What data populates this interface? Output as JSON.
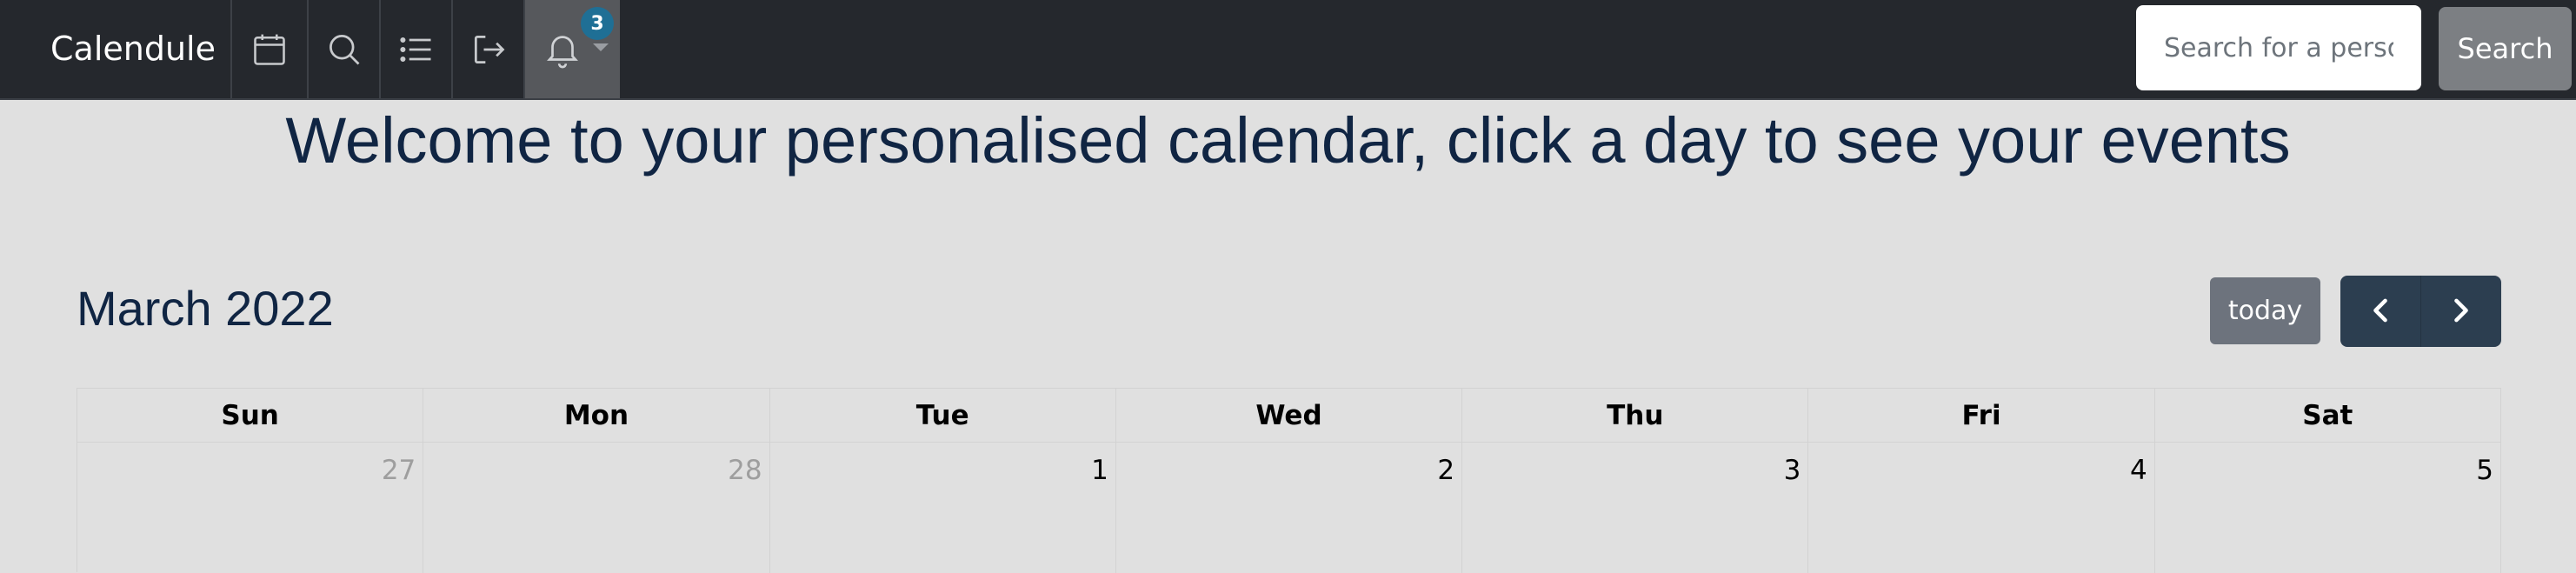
{
  "navbar": {
    "brand": "Calendule",
    "icons": [
      {
        "name": "calendar-icon"
      },
      {
        "name": "search-icon"
      },
      {
        "name": "list-icon"
      },
      {
        "name": "logout-icon"
      },
      {
        "name": "bell-icon",
        "badge": "3"
      }
    ],
    "search": {
      "placeholder": "Search for a person",
      "value": "",
      "button_label": "Search"
    }
  },
  "main": {
    "welcome": "Welcome to your personalised calendar, click a day to see your events"
  },
  "calendar": {
    "month_title": "March 2022",
    "today_label": "today",
    "prev_icon": "chevron-left-icon",
    "next_icon": "chevron-right-icon",
    "weekdays": [
      "Sun",
      "Mon",
      "Tue",
      "Wed",
      "Thu",
      "Fri",
      "Sat"
    ],
    "days": [
      {
        "num": "27",
        "other_month": true
      },
      {
        "num": "28",
        "other_month": true
      },
      {
        "num": "1",
        "other_month": false
      },
      {
        "num": "2",
        "other_month": false
      },
      {
        "num": "3",
        "other_month": false
      },
      {
        "num": "4",
        "other_month": false
      },
      {
        "num": "5",
        "other_month": false
      }
    ]
  },
  "colors": {
    "navbar_bg": "#25282d",
    "page_bg": "#e0e0e0",
    "heading": "#102543",
    "badge": "#1f6f95",
    "nav_button": "#2c3e50"
  }
}
